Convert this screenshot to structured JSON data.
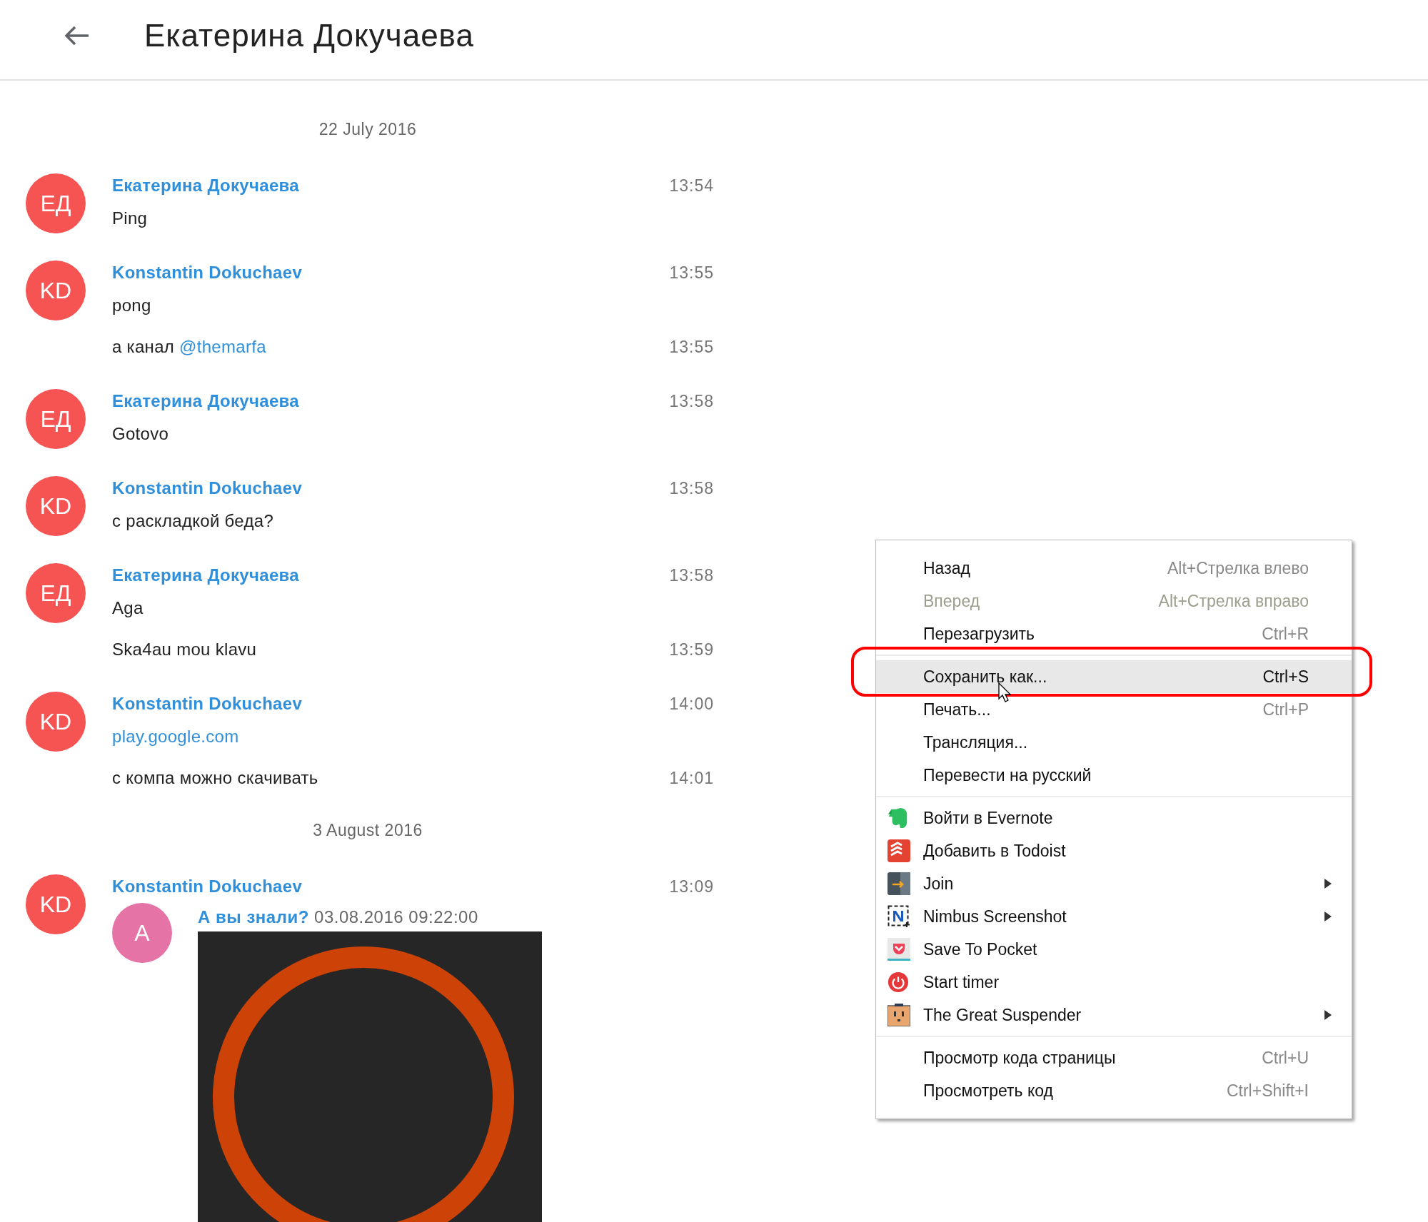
{
  "header": {
    "title": "Екатерина Докучаева"
  },
  "feed": [
    {
      "kind": "date",
      "text": "22 July 2016"
    },
    {
      "kind": "group",
      "initials": "ЕД",
      "color": "#f65353",
      "name": "Екатерина Докучаева",
      "time": "13:54",
      "lines": [
        {
          "kind": "text",
          "text": "Ping"
        }
      ]
    },
    {
      "kind": "group",
      "initials": "KD",
      "color": "#f65353",
      "name": "Konstantin Dokuchaev",
      "time": "13:55",
      "lines": [
        {
          "kind": "text",
          "text": "pong"
        },
        {
          "kind": "mention",
          "text": "а канал ",
          "mention": "@themarfa",
          "time": "13:55"
        }
      ]
    },
    {
      "kind": "group",
      "initials": "ЕД",
      "color": "#f65353",
      "name": "Екатерина Докучаева",
      "time": "13:58",
      "lines": [
        {
          "kind": "text",
          "text": "Gotovo"
        }
      ]
    },
    {
      "kind": "group",
      "initials": "KD",
      "color": "#f65353",
      "name": "Konstantin Dokuchaev",
      "time": "13:58",
      "lines": [
        {
          "kind": "text",
          "text": "с раскладкой беда?"
        }
      ]
    },
    {
      "kind": "group",
      "initials": "ЕД",
      "color": "#f65353",
      "name": "Екатерина Докучаева",
      "time": "13:58",
      "lines": [
        {
          "kind": "text",
          "text": "Aga"
        },
        {
          "kind": "text",
          "text": "Ska4au mou klavu",
          "time": "13:59"
        }
      ]
    },
    {
      "kind": "group",
      "initials": "KD",
      "color": "#f65353",
      "name": "Konstantin Dokuchaev",
      "time": "14:00",
      "lines": [
        {
          "kind": "link",
          "text": "play.google.com"
        },
        {
          "kind": "text",
          "text": "с компа можно скачивать",
          "time": "14:01"
        }
      ]
    },
    {
      "kind": "date",
      "text": "3 August 2016"
    },
    {
      "kind": "group",
      "initials": "KD",
      "color": "#f65353",
      "name": "Konstantin Dokuchaev",
      "time": "13:09",
      "lines": [
        {
          "kind": "forward",
          "initials": "А",
          "color": "#e673a6",
          "source": "А вы знали?",
          "stamp": "03.08.2016 09:22:00"
        }
      ]
    }
  ],
  "context_menu": {
    "sections": [
      [
        {
          "label": "Назад",
          "shortcut": "Alt+Стрелка влево",
          "disabled": false,
          "selected": false,
          "submenu": false
        },
        {
          "label": "Вперед",
          "shortcut": "Alt+Стрелка вправо",
          "disabled": true,
          "selected": false,
          "submenu": false
        },
        {
          "label": "Перезагрузить",
          "shortcut": "Ctrl+R",
          "disabled": false,
          "selected": false,
          "submenu": false
        }
      ],
      [
        {
          "label": "Сохранить как...",
          "shortcut": "Ctrl+S",
          "disabled": false,
          "selected": true,
          "submenu": false
        },
        {
          "label": "Печать...",
          "shortcut": "Ctrl+P",
          "disabled": false,
          "selected": false,
          "submenu": false
        },
        {
          "label": "Трансляция...",
          "disabled": false,
          "selected": false,
          "submenu": false
        },
        {
          "label": "Перевести на русский",
          "disabled": false,
          "selected": false,
          "submenu": false
        }
      ],
      [
        {
          "label": "Войти в Evernote",
          "disabled": false,
          "selected": false,
          "submenu": false
        },
        {
          "label": "Добавить в Todoist",
          "disabled": false,
          "selected": false,
          "submenu": false
        },
        {
          "label": "Join",
          "disabled": false,
          "selected": false,
          "submenu": true
        },
        {
          "label": "Nimbus Screenshot",
          "disabled": false,
          "selected": false,
          "submenu": true
        },
        {
          "label": "Save To Pocket",
          "disabled": false,
          "selected": false,
          "submenu": false
        },
        {
          "label": "Start timer",
          "disabled": false,
          "selected": false,
          "submenu": false
        },
        {
          "label": "The Great Suspender",
          "disabled": false,
          "selected": false,
          "submenu": true
        }
      ],
      [
        {
          "label": "Просмотр кода страницы",
          "shortcut": "Ctrl+U",
          "disabled": false,
          "selected": false,
          "submenu": false
        },
        {
          "label": "Просмотреть код",
          "shortcut": "Ctrl+Shift+I",
          "disabled": false,
          "selected": false,
          "submenu": false
        }
      ]
    ]
  }
}
